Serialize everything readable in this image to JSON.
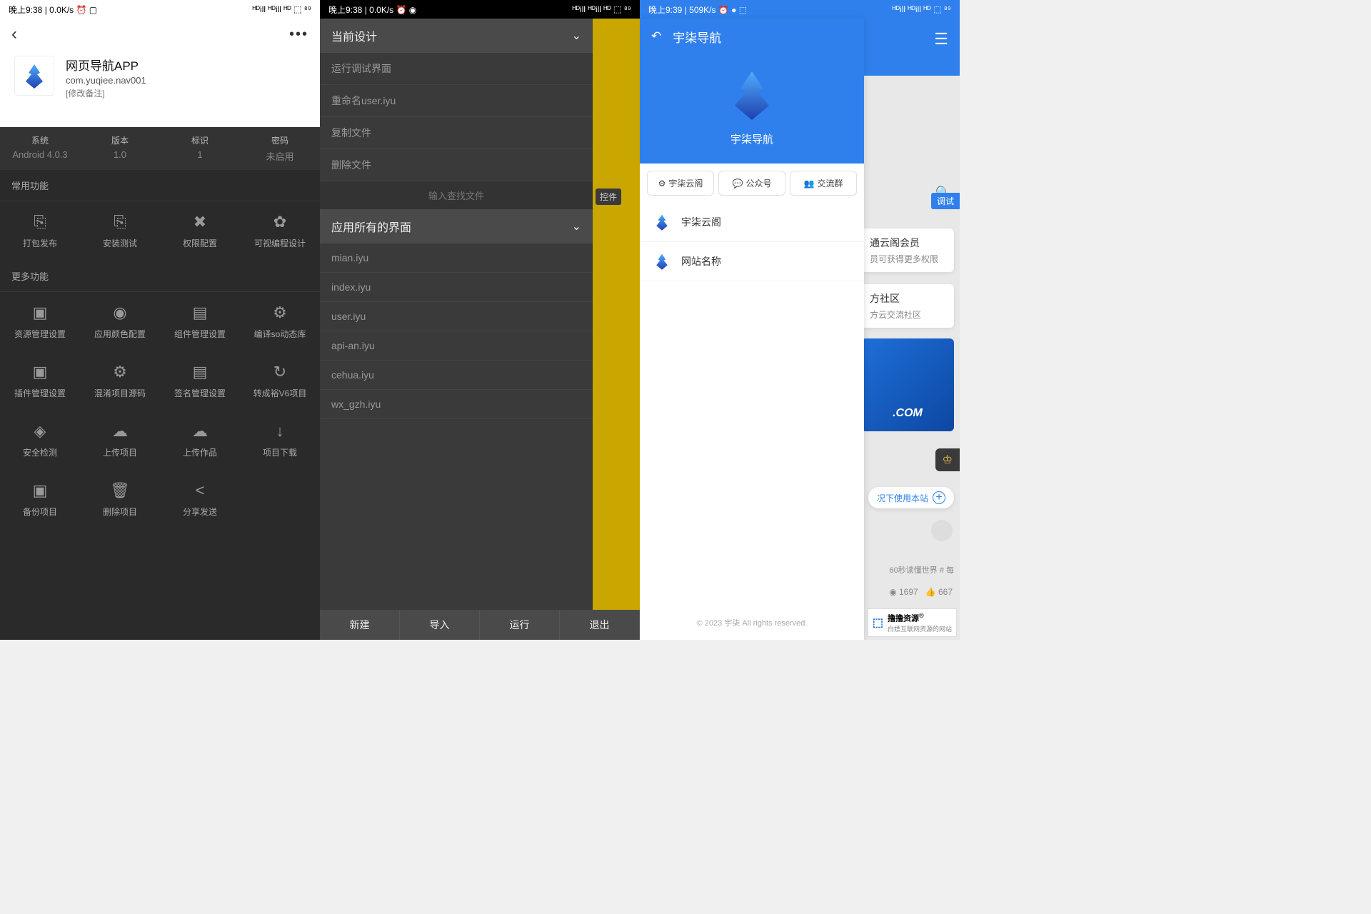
{
  "status": {
    "s1": {
      "left": "晚上9:38 | 0.0K/s ⏰ ▢",
      "right": "ᴴᴰill ᴴᴰill ᴴᴰ ⬚ ⁸⁹"
    },
    "s2": {
      "left": "晚上9:38 | 0.0K/s ⏰ ◉",
      "right": "ᴴᴰill ᴴᴰill ᴴᴰ ⬚ ⁸⁹"
    },
    "s3": {
      "left": "晚上9:39 | 509K/s ⏰ ● ⬚",
      "right": "ᴴᴰill ᴴᴰill ᴴᴰ ⬚ ⁸⁹"
    }
  },
  "s1": {
    "app_name": "网页导航APP",
    "package": "com.yuqiee.nav001",
    "edit_remark": "[修改备注]",
    "info": [
      {
        "label": "系统",
        "value": "Android 4.0.3"
      },
      {
        "label": "版本",
        "value": "1.0"
      },
      {
        "label": "标识",
        "value": "1"
      },
      {
        "label": "密码",
        "value": "未启用"
      }
    ],
    "section1_title": "常用功能",
    "section1": [
      {
        "icon": "⎘",
        "label": "打包发布"
      },
      {
        "icon": "⎘",
        "label": "安装测试"
      },
      {
        "icon": "✖",
        "label": "权限配置"
      },
      {
        "icon": "✿",
        "label": "可视编程设计"
      }
    ],
    "section2_title": "更多功能",
    "section2": [
      {
        "icon": "▣",
        "label": "资源管理设置"
      },
      {
        "icon": "◉",
        "label": "应用颜色配置"
      },
      {
        "icon": "▤",
        "label": "组件管理设置"
      },
      {
        "icon": "⚙",
        "label": "编译so动态库"
      },
      {
        "icon": "▣",
        "label": "插件管理设置"
      },
      {
        "icon": "⚙",
        "label": "混淆项目源码"
      },
      {
        "icon": "▤",
        "label": "签名管理设置"
      },
      {
        "icon": "↻",
        "label": "转成裕V6项目"
      },
      {
        "icon": "◈",
        "label": "安全检测"
      },
      {
        "icon": "☁",
        "label": "上传项目"
      },
      {
        "icon": "☁",
        "label": "上传作品"
      },
      {
        "icon": "↓",
        "label": "项目下载"
      },
      {
        "icon": "▣",
        "label": "备份项目"
      },
      {
        "icon": "🗑",
        "label": "删除项目"
      },
      {
        "icon": "<",
        "label": "分享发送"
      }
    ]
  },
  "s2": {
    "hdr1": "当前设计",
    "design_items": [
      "运行调试界面",
      "重命名user.iyu",
      "复制文件",
      "删除文件"
    ],
    "search_placeholder": "输入查找文件",
    "hdr2": "应用所有的界面",
    "files": [
      "mian.iyu",
      "index.iyu",
      "user.iyu",
      "api-an.iyu",
      "cehua.iyu",
      "wx_gzh.iyu"
    ],
    "side_tag": "控件",
    "bottom": [
      "新建",
      "导入",
      "运行",
      "退出"
    ]
  },
  "s3": {
    "header": "宇柒导航",
    "title": "宇柒导航",
    "chips": [
      {
        "icon": "⚙",
        "label": "宇柒云阁"
      },
      {
        "icon": "💬",
        "label": "公众号"
      },
      {
        "icon": "👥",
        "label": "交流群"
      }
    ],
    "list": [
      {
        "label": "宇柒云阁"
      },
      {
        "label": "网站名称"
      }
    ],
    "footer": "© 2023 宇柒 All rights reserved.",
    "debug": "调试",
    "card1_title": "通云阁会员",
    "card1_sub": "员可获得更多权限",
    "card2_title": "方社区",
    "card2_sub": "方云交流社区",
    "url": ".COM",
    "use_text": "况下使用本站",
    "tags": "60秒读懂世界    # 每",
    "views": "◉ 1697",
    "likes": "👍 667",
    "watermark_main": "撸撸资源",
    "watermark_sub": "白嫖互联网资源的网站",
    "watermark_r": "®"
  }
}
